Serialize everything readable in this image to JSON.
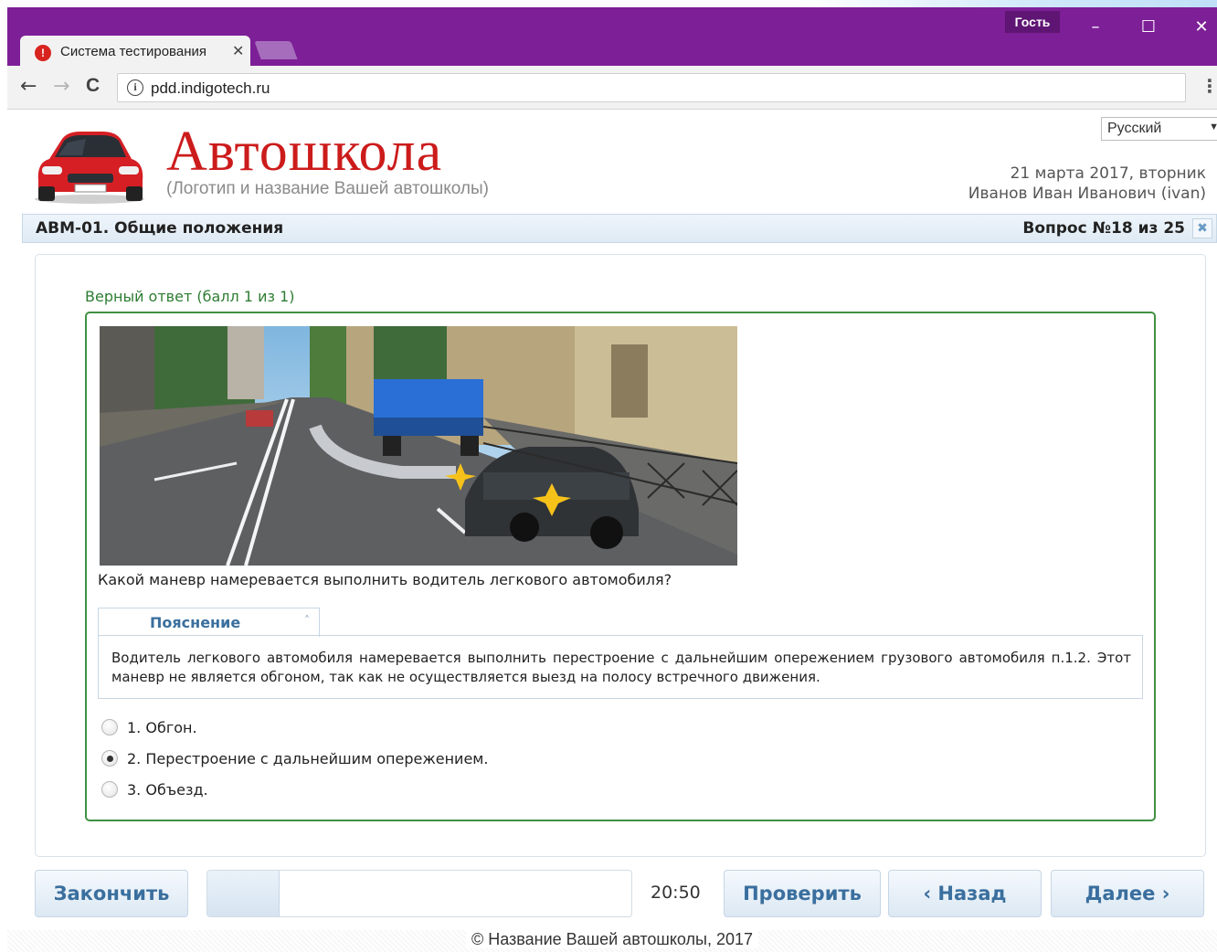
{
  "browser": {
    "tab_title": "Система тестирования",
    "tab_close": "✕",
    "guest_label": "Гость",
    "minimize": "–",
    "maximize": "☐",
    "close": "✕",
    "back_icon": "←",
    "forward_icon": "→",
    "reload_icon": "C",
    "url": "pdd.indigotech.ru",
    "info_icon": "i",
    "menu_icon": "⋮"
  },
  "header": {
    "brand": "Автошкола",
    "brand_sub": "(Логотип и название Вашей автошколы)",
    "language": "Русский",
    "date": "21 марта 2017, вторник",
    "user": "Иванов Иван Иванович (ivan)"
  },
  "qbar": {
    "section": "АВМ-01. Общие положения",
    "counter": "Вопрос №18 из 25",
    "close_icon": "✖"
  },
  "result": {
    "status": "Верный ответ (балл 1 из 1)"
  },
  "question": {
    "text": "Какой маневр намеревается выполнить водитель легкового автомобиля?",
    "explanation_title": "Пояснение",
    "explanation_caret": "˄",
    "explanation": "Водитель легкового автомобиля намеревается выполнить перестроение с дальнейшим опережением грузового автомобиля п.1.2. Этот маневр не является обгоном, так как не осуществляется выезд на полосу встречного движения.",
    "options": [
      {
        "label": "1. Обгон.",
        "selected": false
      },
      {
        "label": "2. Перестроение с дальнейшим опережением.",
        "selected": true
      },
      {
        "label": "3. Объезд.",
        "selected": false
      }
    ]
  },
  "controls": {
    "finish": "Закончить",
    "timer": "20:50",
    "check": "Проверить",
    "back": "‹ Назад",
    "next": "Далее ›",
    "progress_fraction": 0.17
  },
  "footer": {
    "copyright": "© Название Вашей автошколы, 2017"
  },
  "colors": {
    "titlebar": "#7d1f97",
    "brand_red": "#cc1b1b",
    "correct_green": "#2e7d32",
    "button_text": "#3a6f9e"
  }
}
